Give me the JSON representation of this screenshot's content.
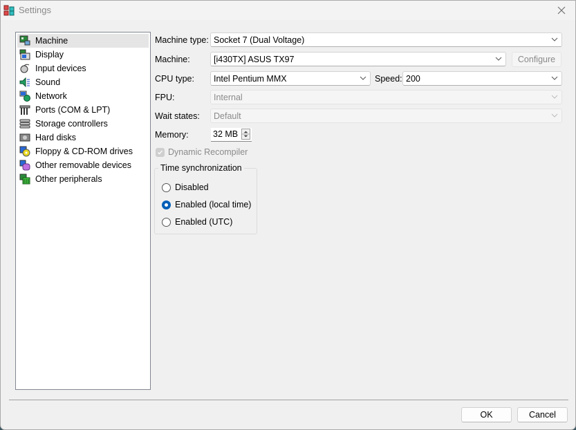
{
  "window": {
    "title": "Settings",
    "close_icon": "close-icon",
    "app_icon": "app-icon"
  },
  "sidebar": {
    "items": [
      {
        "label": "Machine",
        "icon": "machine-icon",
        "selected": true
      },
      {
        "label": "Display",
        "icon": "display-icon",
        "selected": false
      },
      {
        "label": "Input devices",
        "icon": "input-devices-icon",
        "selected": false
      },
      {
        "label": "Sound",
        "icon": "sound-icon",
        "selected": false
      },
      {
        "label": "Network",
        "icon": "network-icon",
        "selected": false
      },
      {
        "label": "Ports (COM & LPT)",
        "icon": "ports-icon",
        "selected": false
      },
      {
        "label": "Storage controllers",
        "icon": "storage-controllers-icon",
        "selected": false
      },
      {
        "label": "Hard disks",
        "icon": "hard-disk-icon",
        "selected": false
      },
      {
        "label": "Floppy & CD-ROM drives",
        "icon": "floppy-cdrom-icon",
        "selected": false
      },
      {
        "label": "Other removable devices",
        "icon": "removable-devices-icon",
        "selected": false
      },
      {
        "label": "Other peripherals",
        "icon": "peripherals-icon",
        "selected": false
      }
    ]
  },
  "machine": {
    "machine_type_label": "Machine type:",
    "machine_type_value": "Socket 7 (Dual Voltage)",
    "machine_label": "Machine:",
    "machine_value": "[i430TX] ASUS TX97",
    "configure_label": "Configure",
    "cpu_type_label": "CPU type:",
    "cpu_type_value": "Intel Pentium MMX",
    "speed_label": "Speed:",
    "speed_value": "200",
    "fpu_label": "FPU:",
    "fpu_value": "Internal",
    "wait_states_label": "Wait states:",
    "wait_states_value": "Default",
    "memory_label": "Memory:",
    "memory_value": "32 MB",
    "dynamic_recompiler_label": "Dynamic Recompiler",
    "dynamic_recompiler_checked": true
  },
  "time_sync": {
    "title": "Time synchronization",
    "options": [
      {
        "label": "Disabled",
        "selected": false
      },
      {
        "label": "Enabled (local time)",
        "selected": true
      },
      {
        "label": "Enabled (UTC)",
        "selected": false
      }
    ]
  },
  "footer": {
    "ok_label": "OK",
    "cancel_label": "Cancel"
  }
}
